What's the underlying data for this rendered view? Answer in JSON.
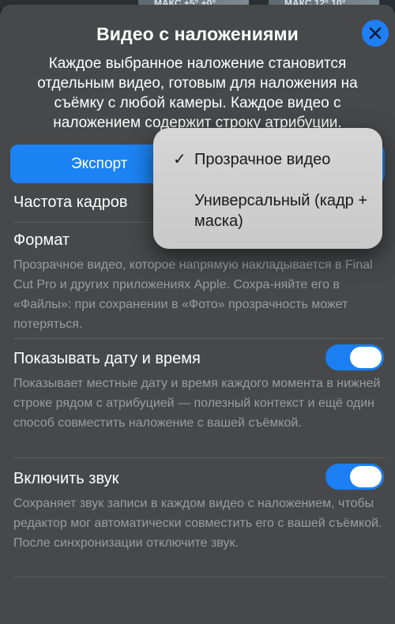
{
  "background": {
    "thumb1": "МАКС +5° +0°",
    "thumb2": "МАКС 12° 10°"
  },
  "sheet": {
    "title": "Видео с наложениями",
    "description": "Каждое выбранное наложение становится отдельным видео, готовым для наложения на съёмку с любой камеры. Каждое видео с наложением содержит строку атрибуции.",
    "close_icon": "close-x",
    "export_label": "Экспорт",
    "frame_rate_label": "Частота кадров",
    "format_label": "Формат",
    "format_hint": "Прозрачное видео, которое напрямую накладывается в Final Cut Pro и других приложениях Apple. Сохра-няйте его в «Файлы»: при сохранении в «Фото» прозрачность может потеряться.",
    "show_datetime_label": "Показывать дату и время",
    "show_datetime_on": true,
    "show_datetime_hint": "Показывает местные дату и время каждого момента в нижней строке рядом с атрибуцией — полезный контекст и ещё один способ совместить наложение с вашей съёмкой.",
    "sound_label": "Включить звук",
    "sound_on": true,
    "sound_hint": "Сохраняет звук записи в каждом видео с наложением, чтобы редактор мог автоматически совместить его с вашей съёмкой. После синхронизации отключите звук."
  },
  "format_menu": {
    "items": [
      {
        "check": "✓",
        "label": "Прозрачное видео",
        "selected": true
      },
      {
        "check": "",
        "label": "Универсальный (кадр + маска)",
        "selected": false
      }
    ]
  },
  "colors": {
    "accent": "#1b83f3",
    "sheet_bg": "#474849",
    "hint_text": "#9b9c9e",
    "menu_bg": "#d0d0d0"
  }
}
